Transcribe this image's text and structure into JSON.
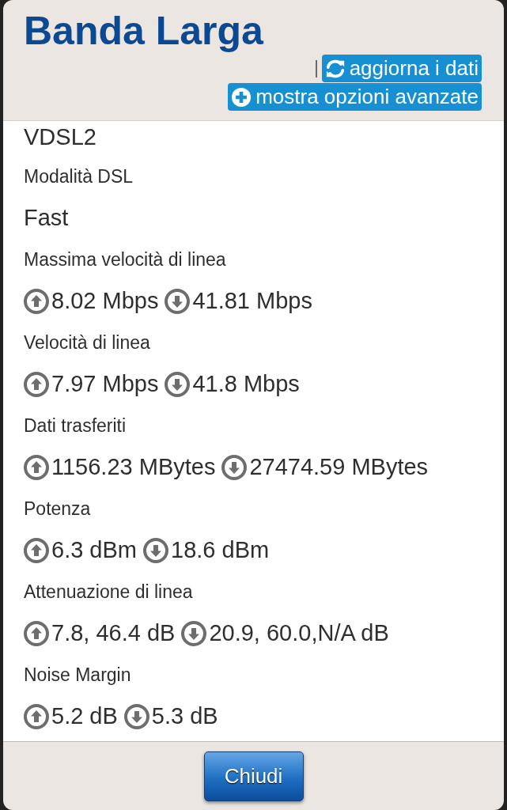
{
  "dialog": {
    "title": "Banda Larga",
    "actions": [
      {
        "kind": "refresh",
        "label": "aggiorna i dati"
      },
      {
        "kind": "expand",
        "label": "mostra opzioni avanzate"
      }
    ]
  },
  "fields": [
    {
      "kind": "value",
      "text": "VDSL2"
    },
    {
      "kind": "label",
      "text": "Modalità DSL"
    },
    {
      "kind": "value",
      "text": "Fast"
    },
    {
      "kind": "label",
      "text": "Massima velocità di linea"
    },
    {
      "kind": "updown",
      "up": "8.02 Mbps",
      "down": "41.81 Mbps"
    },
    {
      "kind": "label",
      "text": "Velocità di linea"
    },
    {
      "kind": "updown",
      "up": "7.97 Mbps",
      "down": "41.8 Mbps"
    },
    {
      "kind": "label",
      "text": "Dati trasferiti"
    },
    {
      "kind": "updown",
      "up": "1156.23 MBytes",
      "down": "27474.59 MBytes"
    },
    {
      "kind": "label",
      "text": "Potenza"
    },
    {
      "kind": "updown",
      "up": "6.3 dBm",
      "down": "18.6 dBm"
    },
    {
      "kind": "label",
      "text": "Attenuazione di linea"
    },
    {
      "kind": "updown",
      "up": "7.8, 46.4 dB",
      "down": "20.9, 60.0,N/A dB"
    },
    {
      "kind": "label",
      "text": "Noise Margin"
    },
    {
      "kind": "updown",
      "up": "5.2 dB",
      "down": "5.3 dB"
    }
  ],
  "footer": {
    "close_button": "Chiudi"
  }
}
